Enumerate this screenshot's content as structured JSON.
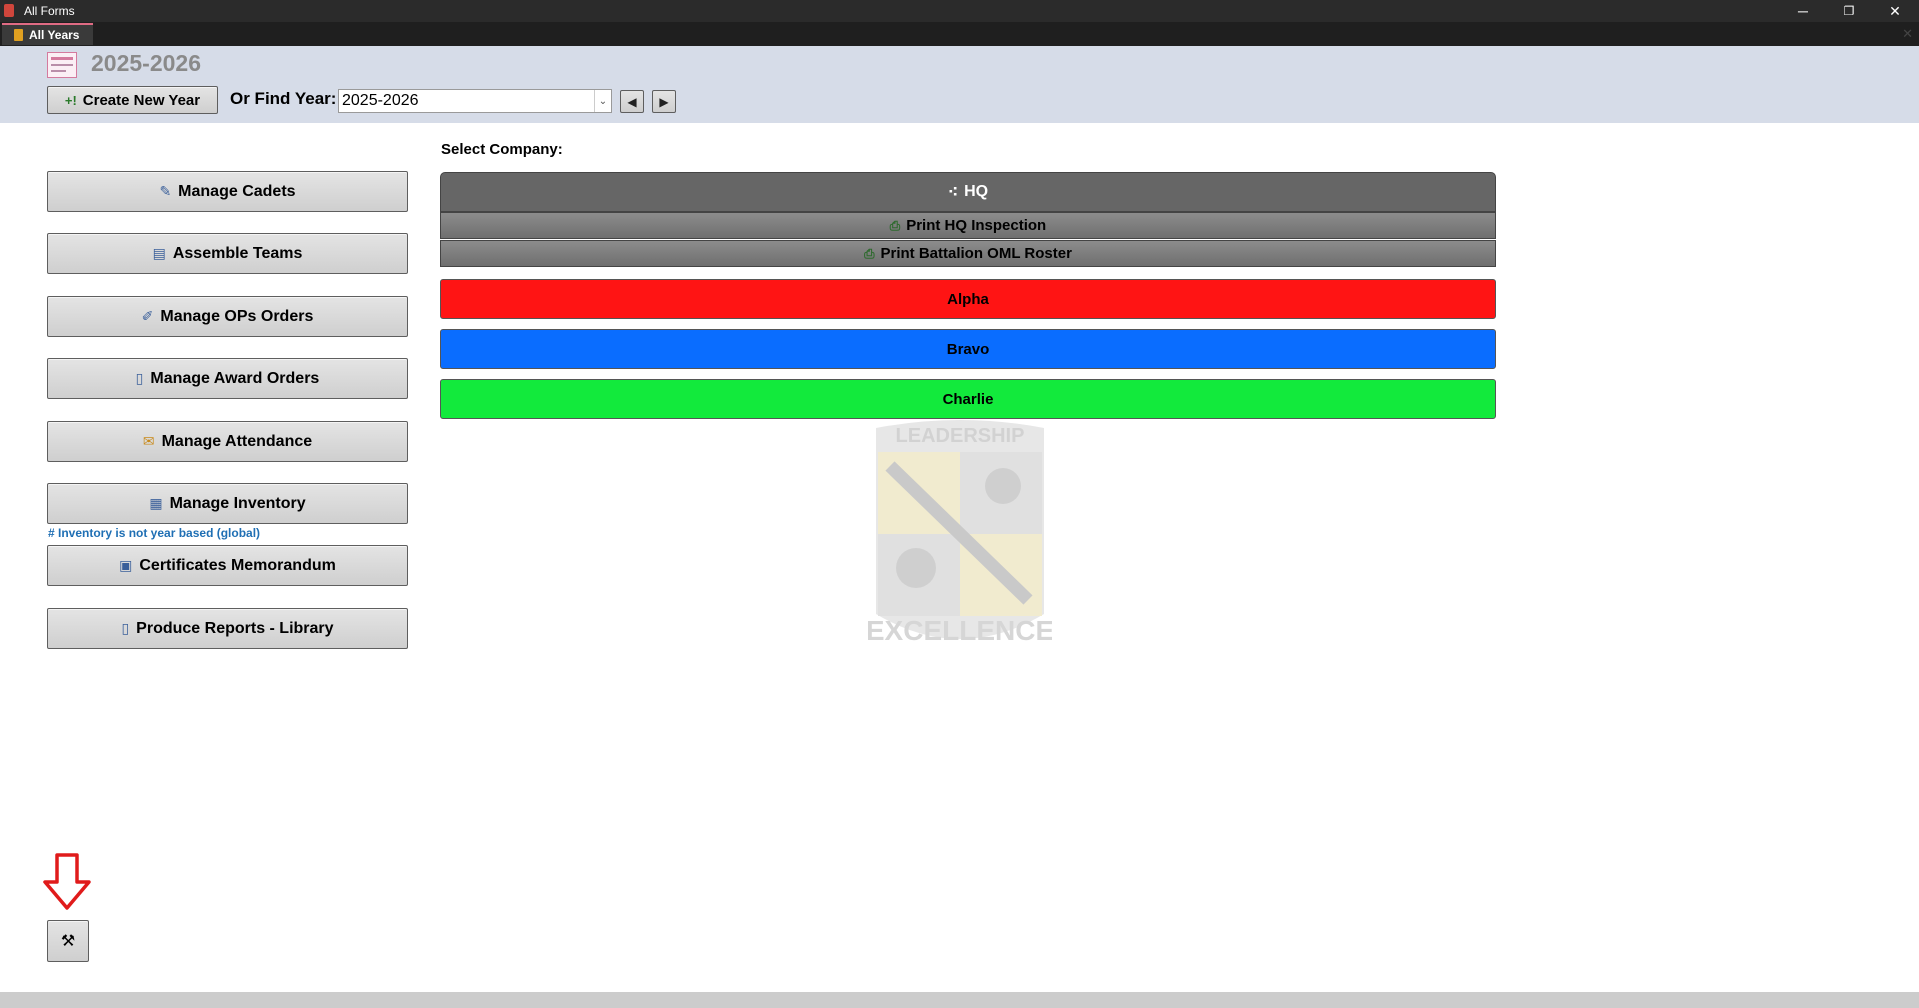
{
  "window": {
    "title": "All Forms",
    "controls": {
      "minimize": "─",
      "restore": "❐",
      "close": "✕"
    }
  },
  "tabs": [
    {
      "label": "All Years",
      "close": "✕"
    }
  ],
  "header": {
    "year_title": "2025-2026",
    "create_button_label": "Create New Year",
    "create_icon": "+!",
    "find_label": "Or Find Year:",
    "find_value": "2025-2026",
    "dropdown_icon": "⌄",
    "prev_icon": "◀",
    "next_icon": "▶"
  },
  "menu": {
    "items": [
      {
        "label": "Manage Cadets",
        "icon": "pencil-icon",
        "glyph": "✎"
      },
      {
        "label": "Assemble Teams",
        "icon": "table-icon",
        "glyph": "▤"
      },
      {
        "label": "Manage OPs Orders",
        "icon": "form-edit-icon",
        "glyph": "✐"
      },
      {
        "label": "Manage Award Orders",
        "icon": "document-icon",
        "glyph": "▯"
      },
      {
        "label": "Manage Attendance",
        "icon": "clipboard-icon",
        "glyph": "✉"
      },
      {
        "label": "Manage Inventory",
        "icon": "grid-icon",
        "glyph": "▦"
      },
      {
        "label": "Certificates Memorandum",
        "icon": "form-icon",
        "glyph": "▣"
      },
      {
        "label": "Produce Reports - Library",
        "icon": "report-icon",
        "glyph": "▯"
      }
    ],
    "inventory_note": "# Inventory is not year based (global)"
  },
  "companies": {
    "select_label": "Select Company:",
    "hq": {
      "label": "HQ",
      "icon": "hierarchy-icon",
      "glyph": "⁖"
    },
    "print_hq": "Print HQ Inspection",
    "print_oml": "Print Battalion OML Roster",
    "print_glyph": "⎙",
    "list": [
      {
        "name": "Alpha",
        "color": "#ff1414"
      },
      {
        "name": "Bravo",
        "color": "#0a6dff"
      },
      {
        "name": "Charlie",
        "color": "#12ea3c"
      }
    ]
  },
  "emblem": {
    "top_text": "LEADERSHIP",
    "bottom_text": "EXCELLENCE"
  },
  "bottom": {
    "tools_glyph": "⚒"
  }
}
